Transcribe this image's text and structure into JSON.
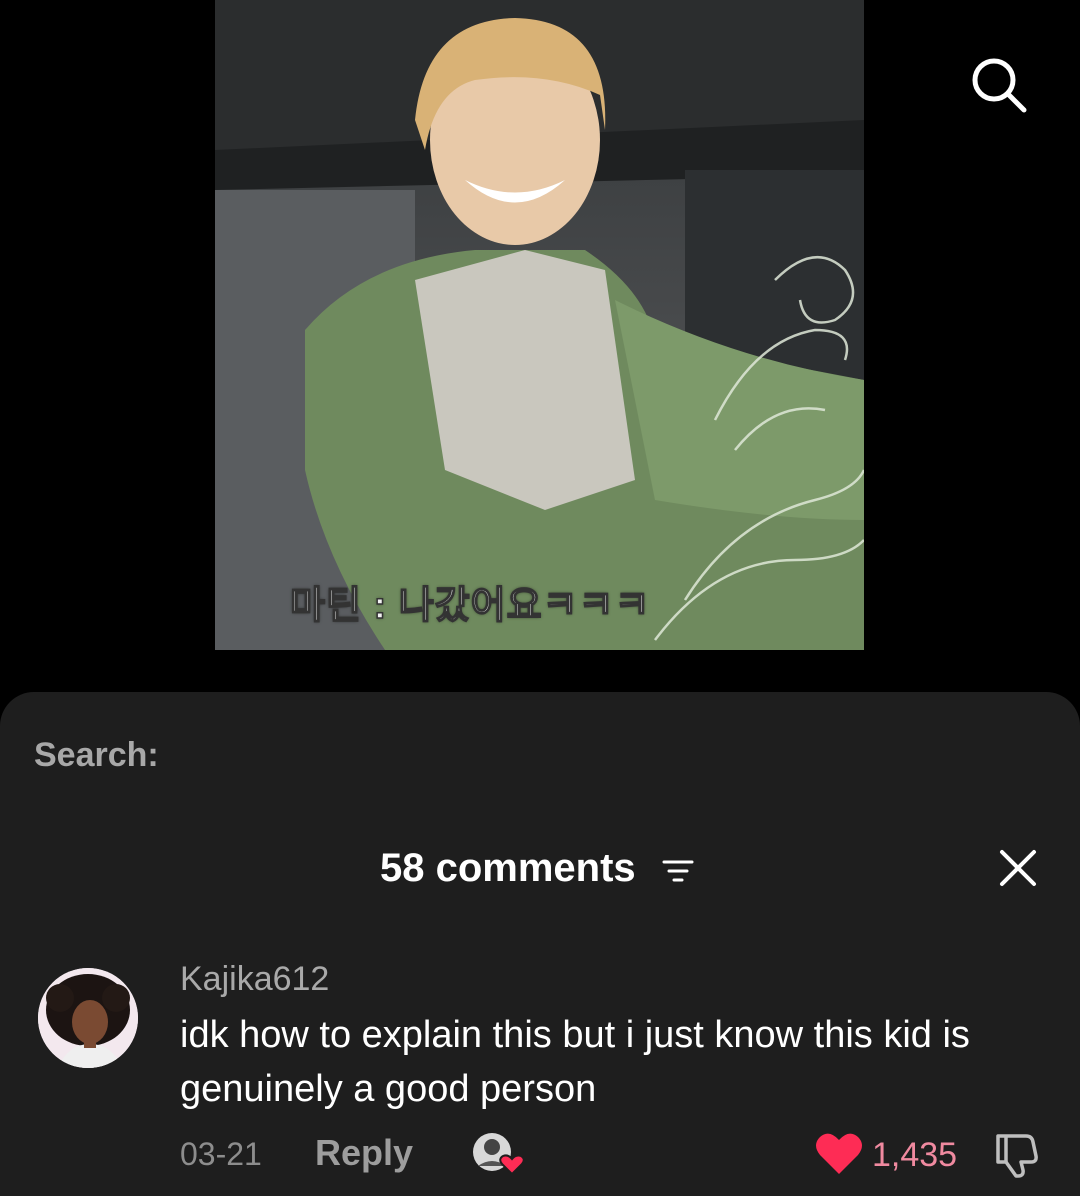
{
  "video": {
    "subtitle": "마틴 : 나갔어요ㅋㅋㅋ"
  },
  "top_bar": {
    "search_icon": "search-icon"
  },
  "comments_sheet": {
    "search_label": "Search:",
    "header": {
      "count_label": "58 comments",
      "sort_icon": "sort-icon",
      "close_icon": "close-icon"
    },
    "comments": [
      {
        "username": "Kajika612",
        "text": "idk how to explain this but i just know this kid is genuinely a good person",
        "date": "03-21",
        "reply_label": "Reply",
        "likes": "1,435",
        "liked": true,
        "liked_by_creator": true
      }
    ]
  },
  "colors": {
    "sheet_bg": "#1e1e1e",
    "like_red": "#fe2c55",
    "like_count": "#f08aa0",
    "muted_text": "#a9a9a9"
  }
}
